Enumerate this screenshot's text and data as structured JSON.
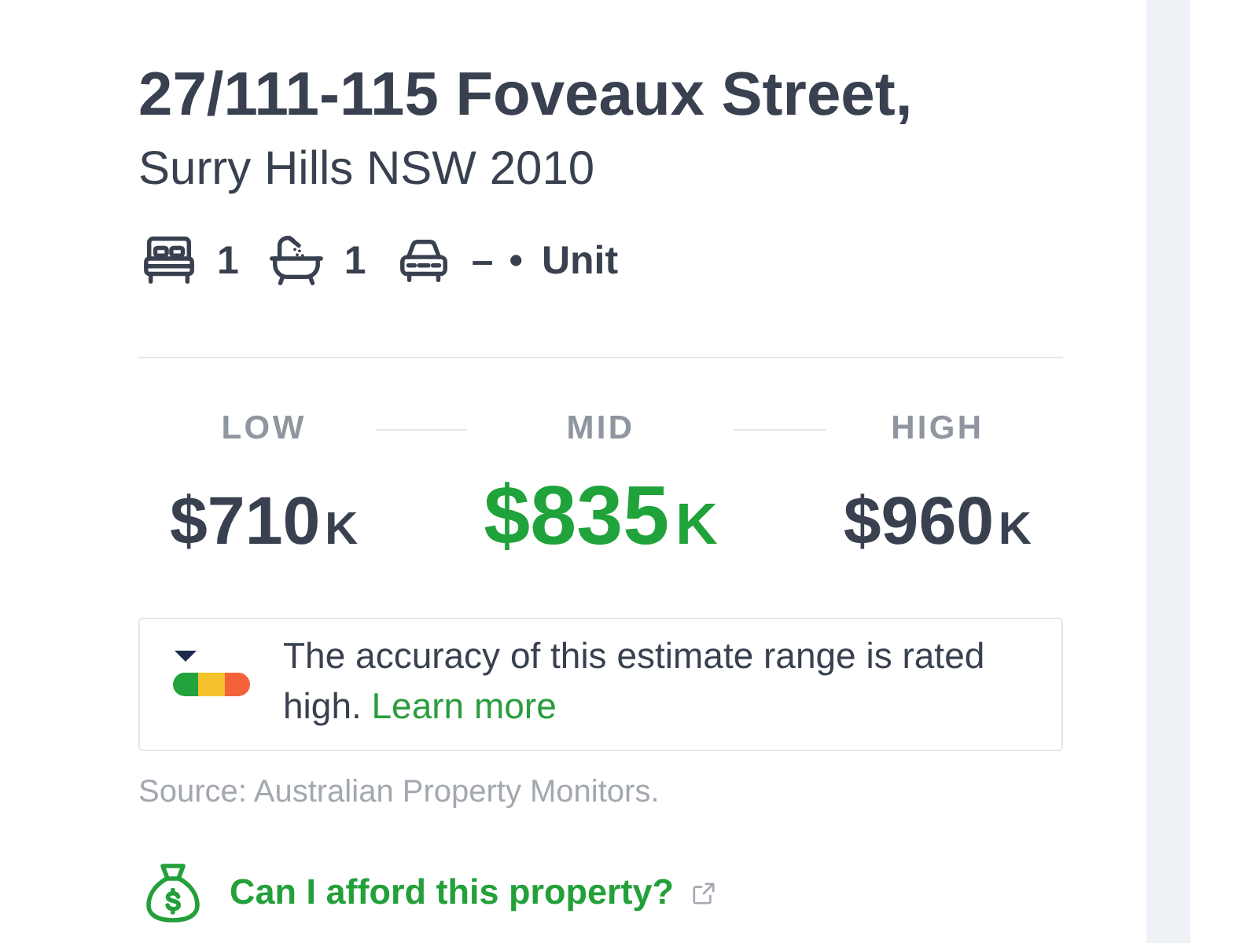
{
  "address": {
    "street": "27/111-115 Foveaux Street,",
    "locality": "Surry Hills NSW 2010"
  },
  "features": [
    {
      "kind": "bed",
      "count": "1"
    },
    {
      "kind": "bath",
      "count": "1"
    },
    {
      "kind": "car",
      "count": "–"
    }
  ],
  "separator": "•",
  "property_type": "Unit",
  "estimates": [
    {
      "label": "LOW",
      "amount": "$710",
      "unit": "K",
      "highlighted": false
    },
    {
      "label": "MID",
      "amount": "$835",
      "unit": "K",
      "highlighted": true
    },
    {
      "label": "HIGH",
      "amount": "$960",
      "unit": "K",
      "highlighted": false
    }
  ],
  "accuracy": {
    "meter": [
      {
        "color": "#22a33c",
        "selected": true
      },
      {
        "color": "#f5c22d",
        "selected": false
      },
      {
        "color": "#f4613b",
        "selected": false
      }
    ],
    "text": "The accuracy of this estimate range is rated high.",
    "link": "Learn more"
  },
  "source": "Source: Australian Property Monitors.",
  "afford_link": "Can I afford this property?"
}
